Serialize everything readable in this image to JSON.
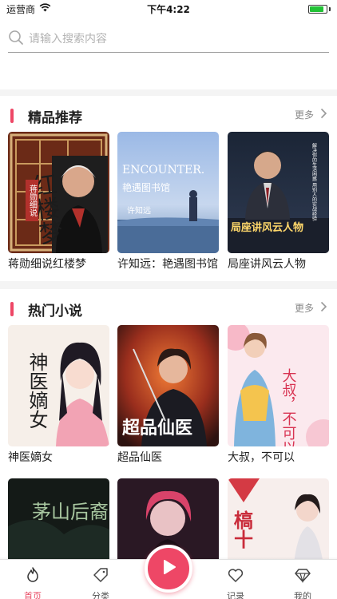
{
  "status_bar": {
    "carrier": "运营商",
    "time": "下午4:22",
    "battery_level": 0.85
  },
  "search": {
    "placeholder": "请输入搜索内容"
  },
  "featured": {
    "title": "精品推荐",
    "more": "更多",
    "items": [
      {
        "title": "蒋勋细说红楼梦",
        "cover_text": "红楼梦",
        "cover_sub": "蒋勋细说"
      },
      {
        "title": "许知远：艳遇图书馆",
        "cover_text": "ENCOUNTER.",
        "cover_sub": "艳遇图书馆",
        "cover_author": "许知远"
      },
      {
        "title": "局座讲风云人物",
        "cover_text": "局座讲风云人物",
        "cover_sub": "解决你的生活困惑 用别人的实战经验"
      }
    ]
  },
  "novels": {
    "title": "热门小说",
    "more": "更多",
    "items": [
      {
        "title": "神医嫡女",
        "cover_text": "神医嫡女"
      },
      {
        "title": "超品仙医",
        "cover_text": "超品仙医"
      },
      {
        "title": "大叔，不可以",
        "cover_text": "大叔，不可以"
      },
      {
        "title": "",
        "cover_text": "茅山后裔"
      },
      {
        "title": "",
        "cover_text": ""
      },
      {
        "title": "",
        "cover_text": "槁十"
      }
    ]
  },
  "tabs": [
    {
      "label": "首页",
      "icon": "home-icon",
      "active": true
    },
    {
      "label": "分类",
      "icon": "tag-icon",
      "active": false
    },
    {
      "label": "记录",
      "icon": "heart-icon",
      "active": false
    },
    {
      "label": "我的",
      "icon": "diamond-icon",
      "active": false
    }
  ],
  "colors": {
    "accent": "#ee4766",
    "battery": "#22c236"
  }
}
